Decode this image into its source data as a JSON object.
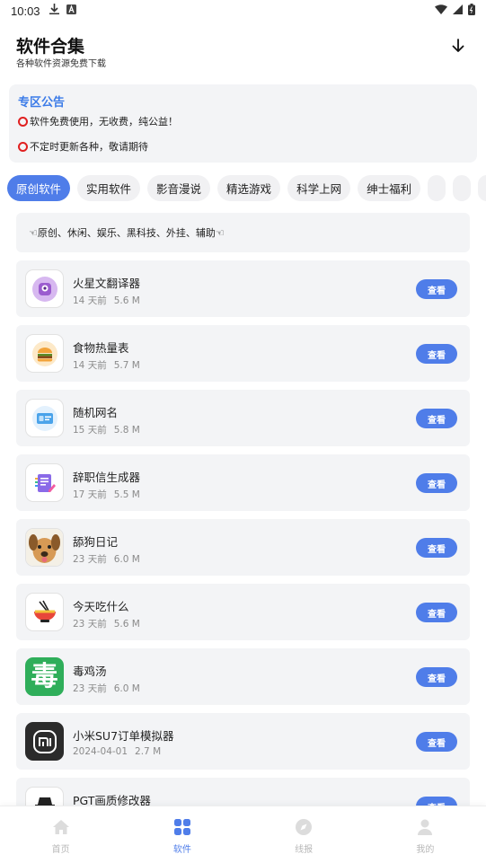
{
  "status_bar": {
    "time": "10:03"
  },
  "header": {
    "title": "软件合集",
    "subtitle": "各种软件资源免费下载",
    "download_icon": "download-arrow-icon"
  },
  "notice": {
    "title": "专区公告",
    "lines": [
      "软件免费使用，无收费，纯公益！",
      "不定时更新各种，敬请期待"
    ]
  },
  "tabs": [
    "原创软件",
    "实用软件",
    "影音漫说",
    "精选游戏",
    "科学上网",
    "绅士福利",
    "",
    "",
    ""
  ],
  "active_tab": "原创软件",
  "category_banner": "☜原创、休闲、娱乐、黑科技、外挂、辅助☜",
  "apps": [
    {
      "name": "火星文翻译器",
      "time": "14 天前",
      "size": "5.6 M",
      "button": "查看",
      "icon": "mars-translator-icon"
    },
    {
      "name": "食物热量表",
      "time": "14 天前",
      "size": "5.7 M",
      "button": "查看",
      "icon": "burger-icon"
    },
    {
      "name": "随机网名",
      "time": "15 天前",
      "size": "5.8 M",
      "button": "查看",
      "icon": "id-card-icon"
    },
    {
      "name": "辞职信生成器",
      "time": "17 天前",
      "size": "5.5 M",
      "button": "查看",
      "icon": "letter-pen-icon"
    },
    {
      "name": "舔狗日记",
      "time": "23 天前",
      "size": "6.0 M",
      "button": "查看",
      "icon": "dog-face-icon"
    },
    {
      "name": "今天吃什么",
      "time": "23 天前",
      "size": "5.6 M",
      "button": "查看",
      "icon": "noodle-bowl-icon"
    },
    {
      "name": "毒鸡汤",
      "time": "23 天前",
      "size": "6.0 M",
      "button": "查看",
      "icon": "poison-glyph-icon",
      "glyph": "毒"
    },
    {
      "name": "小米SU7订单模拟器",
      "time": "2024-04-01",
      "size": "2.7 M",
      "button": "查看",
      "icon": "xiaomi-logo-icon",
      "glyph": "mi"
    },
    {
      "name": "PGT画质修改器",
      "time": "",
      "size": "",
      "button": "查看",
      "icon": "pgt-hat-icon"
    }
  ],
  "bottom_nav": [
    {
      "label": "首页",
      "icon": "home-icon"
    },
    {
      "label": "软件",
      "icon": "grid-icon"
    },
    {
      "label": "线报",
      "icon": "compass-icon"
    },
    {
      "label": "我的",
      "icon": "user-icon"
    }
  ],
  "active_nav": "软件",
  "colors": {
    "accent": "#4f7de9",
    "notice_title": "#3b7be8",
    "card_bg": "#f3f4f6",
    "muted": "#8a8a8a"
  }
}
